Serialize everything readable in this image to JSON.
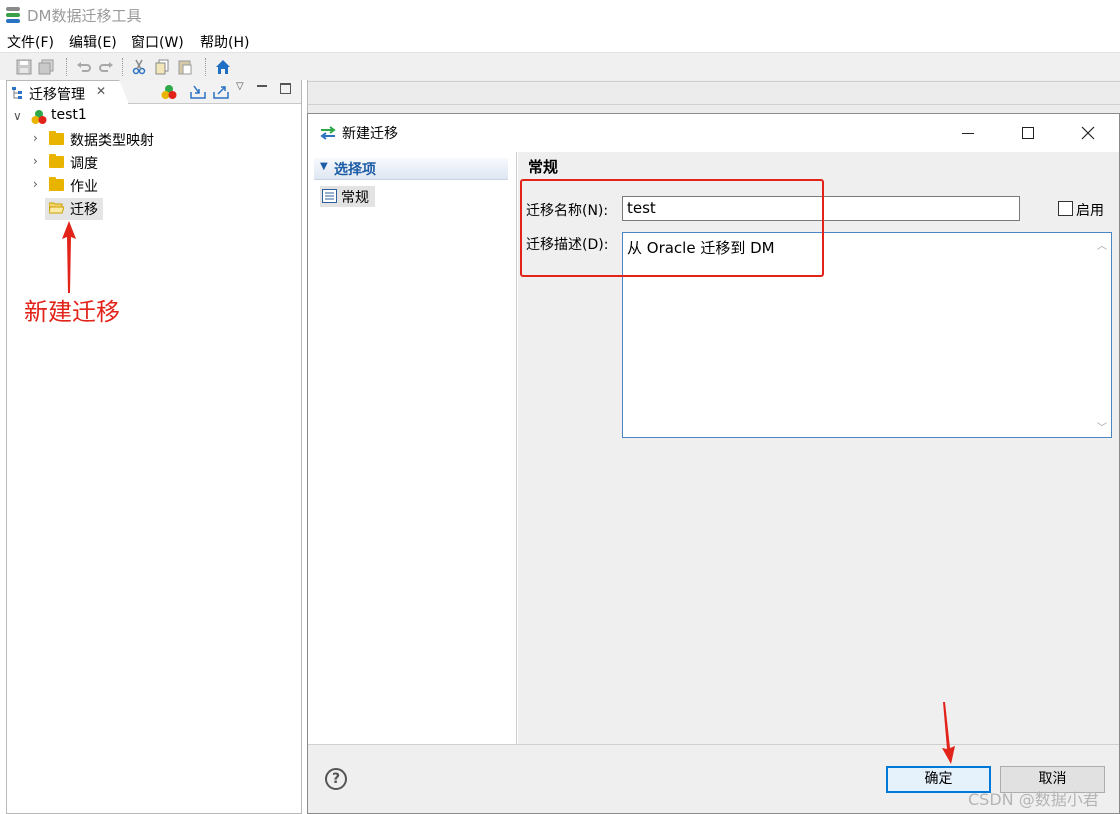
{
  "app": {
    "title": "DM数据迁移工具"
  },
  "menu": {
    "items": [
      "文件(F)",
      "编辑(E)",
      "窗口(W)",
      "帮助(H)"
    ]
  },
  "toolbar": {
    "icons": [
      "save-icon",
      "save-all-icon",
      "undo-icon",
      "redo-icon",
      "cut-icon",
      "copy-icon",
      "paste-icon",
      "home-icon"
    ]
  },
  "left_panel": {
    "tab_label": "迁移管理",
    "tree": {
      "root": "test1",
      "children": [
        "数据类型映射",
        "调度",
        "作业",
        "迁移"
      ]
    },
    "annotation": "新建迁移"
  },
  "dialog": {
    "title": "新建迁移",
    "nav": {
      "header": "选择项",
      "item": "常规"
    },
    "section_title": "常规",
    "fields": {
      "name_label": "迁移名称(N):",
      "name_value": "test",
      "enable_label": "启用",
      "desc_label": "迁移描述(D):",
      "desc_value": "从 Oracle 迁移到 DM"
    },
    "buttons": {
      "ok": "确定",
      "cancel": "取消"
    }
  },
  "watermark": "CSDN @数据小君",
  "colors": {
    "annotation": "#e2231a",
    "accent": "#0078d7",
    "folder": "#e8b400"
  }
}
